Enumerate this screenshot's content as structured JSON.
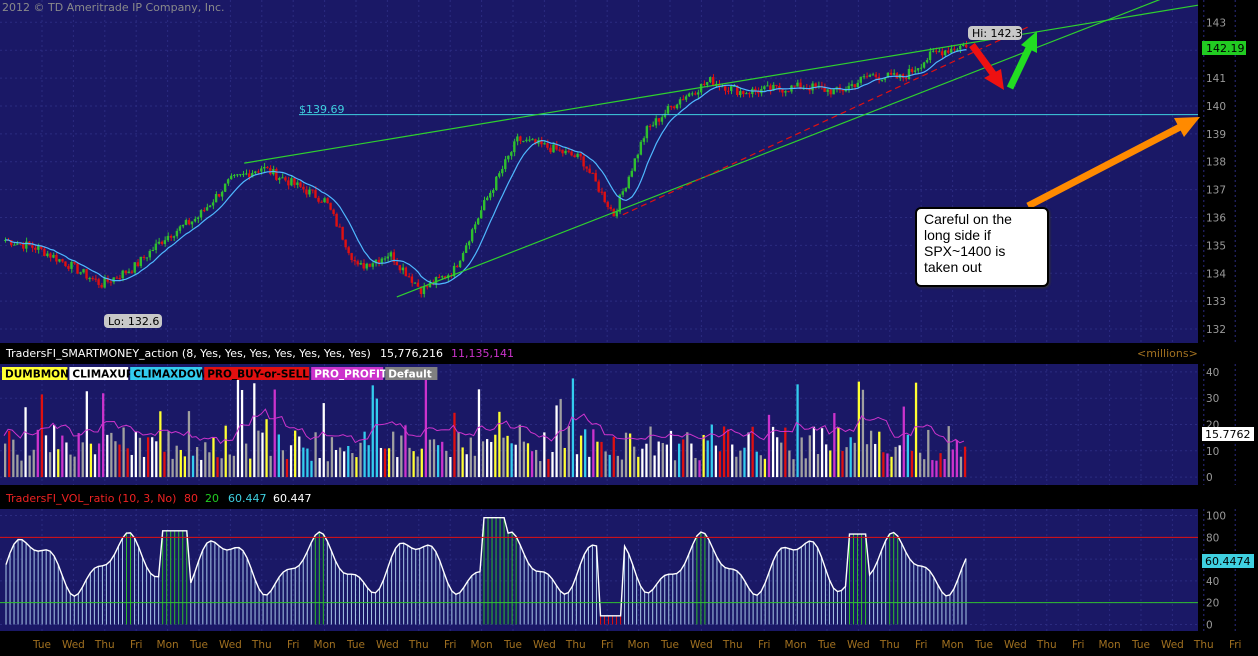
{
  "copyright": "2012 © TD Ameritrade IP Company, Inc.",
  "colors": {
    "background": "#1a1866",
    "grid": "#2b2b80",
    "trendline": "#2fd02f",
    "hline": "#3fd0e0",
    "ma": "#4fb8ff",
    "up": "#2fbf2f",
    "down": "#e01010",
    "arrow_red": "#ee1111",
    "arrow_green": "#22dd22",
    "arrow_orange": "#ff8a00",
    "price_label": "#22cc22",
    "magenta": "#cc33cc",
    "yellow": "#ffff33",
    "cyan": "#33ccee",
    "white": "#ffffff",
    "gray": "#a0a0a0"
  },
  "price_panel": {
    "hi_label": "Hi: 142.3",
    "lo_label": "Lo: 132.6",
    "last_price": "142.19",
    "hline_label": "$139.69",
    "callout_lines": [
      "Careful on the",
      "long side if",
      "SPX~1400 is",
      "taken out"
    ]
  },
  "volume_panel": {
    "study_title": "TradersFI_SMARTMONEY_action (8, Yes, Yes, Yes, Yes, Yes, Yes, Yes)",
    "value1": "15,776,216",
    "value2": "11,135,141",
    "units": "<millions>",
    "last_value": "15.7762",
    "legend": [
      {
        "label": "DUMBMONEY",
        "bg": "#ffff33",
        "fg": "#000000"
      },
      {
        "label": "CLIMAXUP",
        "bg": "#ffffff",
        "fg": "#000000"
      },
      {
        "label": "CLIMAXDOWN",
        "bg": "#33ccee",
        "fg": "#000000"
      },
      {
        "label": "PRO_BUY-or-SELL",
        "bg": "#e01010",
        "fg": "#000000"
      },
      {
        "label": "PRO_PROFIT",
        "bg": "#cc33cc",
        "fg": "#ffffff"
      },
      {
        "label": "Default",
        "bg": "#808080",
        "fg": "#ffffff"
      }
    ]
  },
  "ratio_panel": {
    "study_title": "TradersFI_VOL_ratio (10, 3, No)",
    "v1": "80",
    "v2": "20",
    "v3": "60.447",
    "v4": "60.447",
    "last_value": "60.4474"
  },
  "chart_data": [
    {
      "type": "candlestick",
      "title": "",
      "ylim": [
        131.5,
        143.8
      ],
      "yticks": [
        "132",
        "133",
        "134",
        "135",
        "136",
        "137",
        "138",
        "139",
        "140",
        "141",
        "142",
        "143"
      ],
      "x_days": [
        "Tue",
        "Wed",
        "Thu",
        "Fri",
        "Mon",
        "Tue",
        "Wed",
        "Thu",
        "Fri",
        "Mon",
        "Tue",
        "Wed",
        "Thu",
        "Fri",
        "Mon",
        "Tue",
        "Wed",
        "Thu",
        "Fri",
        "Mon",
        "Tue",
        "Wed",
        "Thu",
        "Fri",
        "Mon",
        "Tue",
        "Wed",
        "Thu",
        "Fri",
        "Mon",
        "Tue",
        "Wed",
        "Thu",
        "Fri",
        "Mon",
        "Tue",
        "Wed",
        "Thu",
        "Fri"
      ],
      "close_path": [
        [
          0,
          135.2
        ],
        [
          1,
          134.9
        ],
        [
          2,
          134.3
        ],
        [
          3,
          133.6
        ],
        [
          4,
          134.2
        ],
        [
          5,
          135.3
        ],
        [
          6,
          136.0
        ],
        [
          7,
          137.3
        ],
        [
          8,
          137.8
        ],
        [
          9,
          137.2
        ],
        [
          10,
          136.6
        ],
        [
          11,
          134.2
        ],
        [
          12,
          134.7
        ],
        [
          13,
          133.4
        ],
        [
          14,
          134.1
        ],
        [
          15,
          136.6
        ],
        [
          16,
          138.8
        ],
        [
          17,
          138.5
        ],
        [
          18,
          138.1
        ],
        [
          19,
          136.1
        ],
        [
          20,
          139.1
        ],
        [
          21,
          140.2
        ],
        [
          22,
          140.9
        ],
        [
          23,
          140.5
        ],
        [
          24,
          140.6
        ],
        [
          25,
          140.7
        ],
        [
          26,
          140.5
        ],
        [
          27,
          141.1
        ],
        [
          28,
          141.0
        ],
        [
          29,
          141.9
        ],
        [
          30,
          142.2
        ]
      ],
      "hline": 139.69,
      "hi": 142.3,
      "lo": 132.6,
      "last": 142.19
    },
    {
      "type": "bar",
      "title": "",
      "ylim": [
        -3,
        43
      ],
      "yticks": [
        "0",
        "10",
        "20",
        "30",
        "40"
      ],
      "last": 15.7762
    },
    {
      "type": "area",
      "title": "",
      "ylim": [
        -6,
        106
      ],
      "yticks": [
        "0",
        "20",
        "40",
        "60",
        "80",
        "100"
      ],
      "hlines": [
        80,
        20
      ],
      "last": 60.4474
    }
  ]
}
